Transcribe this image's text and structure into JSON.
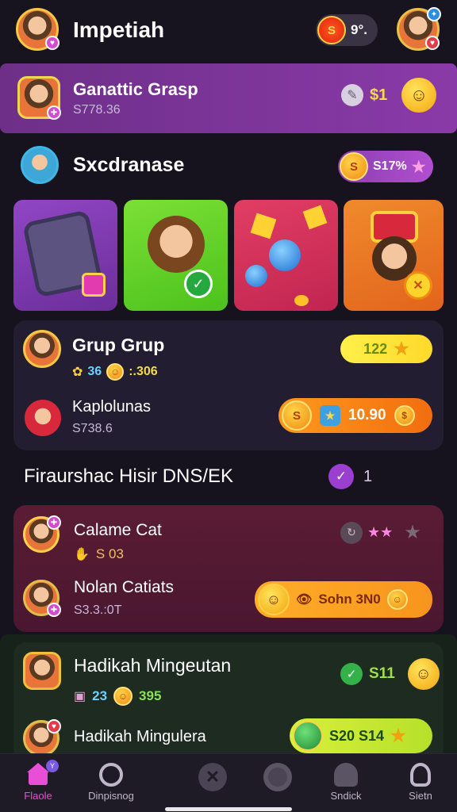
{
  "header": {
    "title": "Impetiah",
    "coin_label": "S",
    "coin_value": "9°."
  },
  "banner": {
    "title": "Ganattic Grasp",
    "subtitle": "S778.36",
    "value": "$1"
  },
  "section1": {
    "title": "Sxcdranase",
    "pill_label": "S",
    "pill_value": "S17%"
  },
  "group_card": {
    "row1_title": "Grup Grup",
    "row1_stat1": "36",
    "row1_stat2": ":.306",
    "row1_pill": "122",
    "row2_title": "Kaplolunas",
    "row2_subtitle": "S738.6",
    "row2_pill": "10.90"
  },
  "section2": {
    "title": "Firaurshac Hisir DNS/EK",
    "count": "1"
  },
  "card2": {
    "row1_title": "Calame Cat",
    "row1_stat": "S 03",
    "row2_title": "Nolan Catiats",
    "row2_subtitle": "S3.3.:0T",
    "row2_pill": "Sohn 3N0"
  },
  "card3": {
    "row1_title": "Hadikah Mingeutan",
    "row1_stat1": "23",
    "row1_stat2": "395",
    "row1_pill": "S11",
    "row2_title": "Hadikah Mingulera",
    "row2_pill": "S20 S14"
  },
  "nav": [
    {
      "label": "Flaole",
      "icon": "home-icon"
    },
    {
      "label": "Dinpisnog",
      "icon": "search-icon"
    },
    {
      "label": "",
      "icon": "close-icon"
    },
    {
      "label": "",
      "icon": "chat-icon"
    },
    {
      "label": "Sndick",
      "icon": "profile-icon"
    },
    {
      "label": "Sietn",
      "icon": "user-icon"
    }
  ],
  "colors": {
    "background": "#16121e",
    "banner": "#7a3596",
    "accent_orange": "#f7941d",
    "accent_yellow": "#ffe22e",
    "accent_green": "#5ed12b",
    "nav_active": "#e84fd6"
  }
}
